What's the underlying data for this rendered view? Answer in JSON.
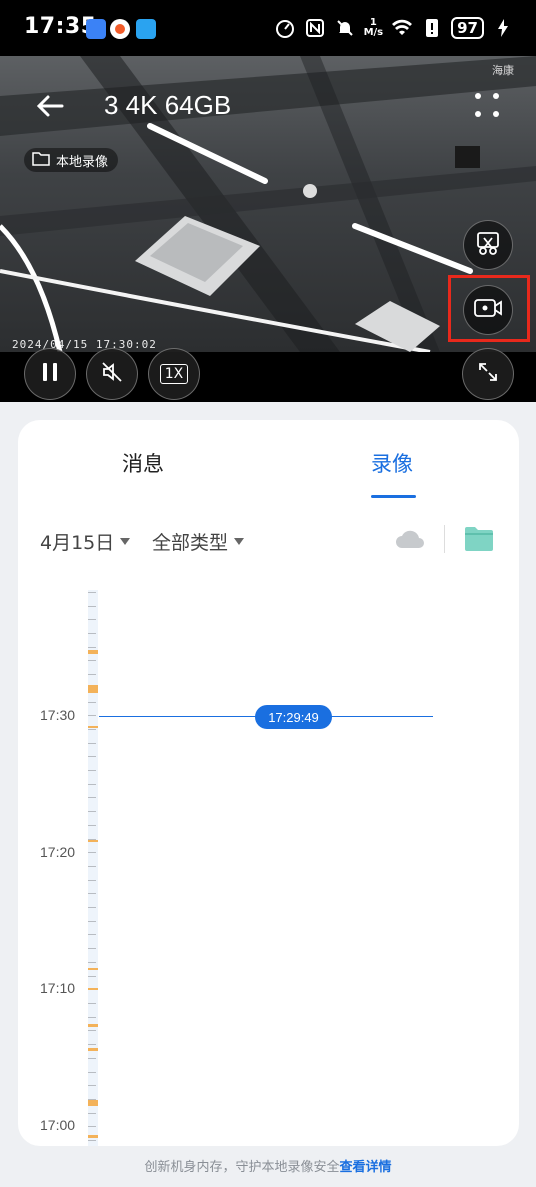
{
  "status_bar": {
    "time": "17:35",
    "speed_value": "1",
    "speed_unit": "M/s",
    "battery": "97"
  },
  "player": {
    "title": "3 4K 64GB",
    "local_chip": "本地录像",
    "timestamp": "2024/04/15  17:30:02",
    "speed_label": "1X",
    "brand": "海康"
  },
  "tabs": [
    {
      "label": "消息",
      "active": false
    },
    {
      "label": "录像",
      "active": true
    }
  ],
  "filters": {
    "date": "4月15日",
    "type": "全部类型"
  },
  "timeline": {
    "labels": [
      "17:30",
      "17:20",
      "17:10",
      "17:00"
    ],
    "cursor_time": "17:29:49"
  },
  "footer": {
    "text": "创新机身内存，守护本地录像安全",
    "link": "查看详情"
  },
  "colors": {
    "accent": "#1a6fe0",
    "record_segment": "#f3b25a",
    "highlight_frame": "#e8291c"
  }
}
